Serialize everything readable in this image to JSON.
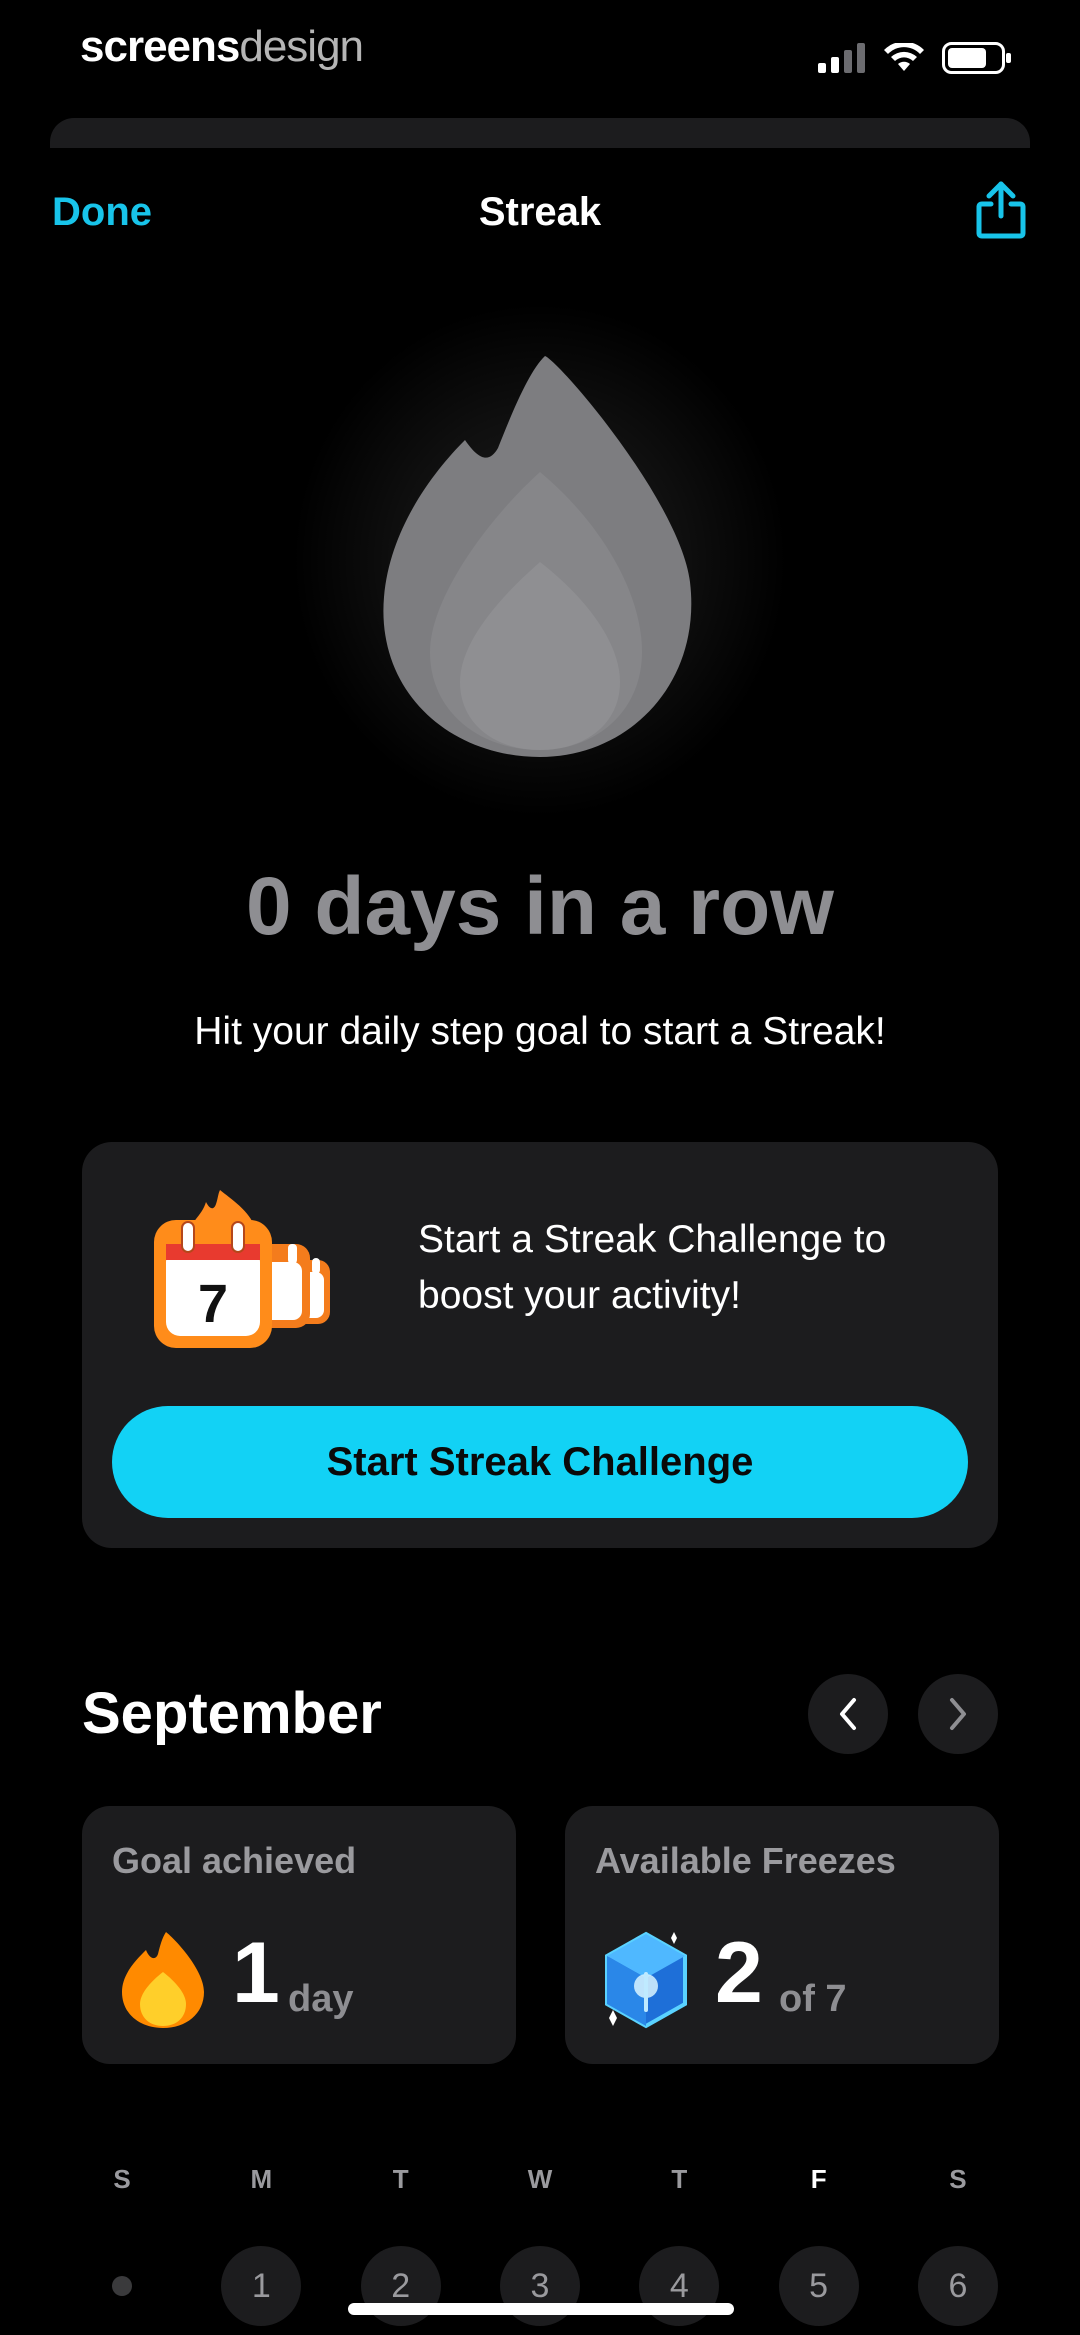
{
  "watermark": {
    "part1": "screens",
    "part2": "design"
  },
  "nav": {
    "done_label": "Done",
    "title": "Streak"
  },
  "streak": {
    "count_text": "0 days in a row",
    "hint": "Hit your daily step goal to start a Streak!"
  },
  "challenge": {
    "text": "Start a Streak Challenge to boost your activity!",
    "calendar_number": "7",
    "cta_label": "Start Streak Challenge"
  },
  "calendar": {
    "month": "September",
    "weekdays": [
      "S",
      "M",
      "T",
      "W",
      "T",
      "F",
      "S"
    ],
    "today_index": 5,
    "days": [
      "",
      "1",
      "2",
      "3",
      "4",
      "5",
      "6"
    ]
  },
  "stats": {
    "goal": {
      "label": "Goal achieved",
      "value": "1",
      "unit": "day"
    },
    "freezes": {
      "label": "Available Freezes",
      "value": "2",
      "unit": "of 7"
    }
  },
  "colors": {
    "accent": "#12d2f5",
    "link": "#18c4ea",
    "card": "#1c1c1e",
    "flame": "#ff9f0a"
  }
}
